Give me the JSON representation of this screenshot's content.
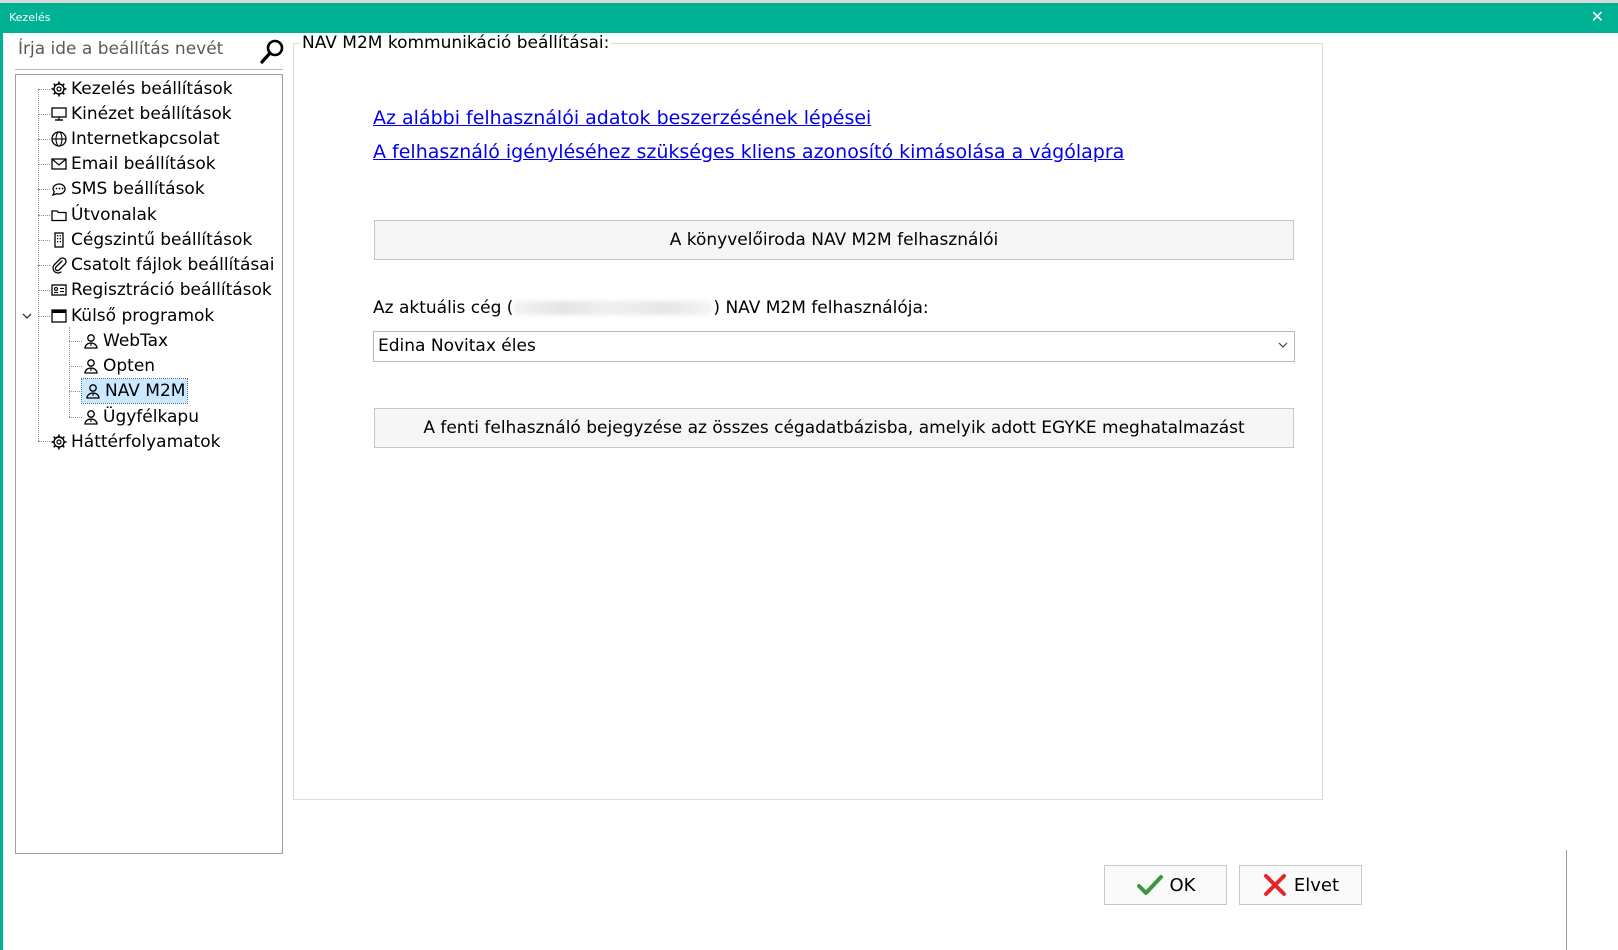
{
  "window": {
    "title": "Kezelés",
    "close_glyph": "✕"
  },
  "search": {
    "placeholder": "Írja ide a beállítás nevét",
    "icon": "search-icon"
  },
  "tree": {
    "items": [
      {
        "label": "Kezelés beállítások",
        "icon": "gear-icon"
      },
      {
        "label": "Kinézet beállítások",
        "icon": "monitor-icon"
      },
      {
        "label": "Internetkapcsolat",
        "icon": "globe-icon"
      },
      {
        "label": "Email beállítások",
        "icon": "envelope-icon"
      },
      {
        "label": "SMS beállítások",
        "icon": "chat-bubble-icon"
      },
      {
        "label": "Útvonalak",
        "icon": "folder-icon"
      },
      {
        "label": "Cégszintű beállítások",
        "icon": "building-icon"
      },
      {
        "label": "Csatolt fájlok beállításai",
        "icon": "paperclip-icon"
      },
      {
        "label": "Regisztráció beállítások",
        "icon": "id-card-icon"
      },
      {
        "label": "Külső programok",
        "icon": "window-icon",
        "expanded": true
      },
      {
        "label": "WebTax",
        "icon": "user-icon"
      },
      {
        "label": "Opten",
        "icon": "user-icon"
      },
      {
        "label": "NAV M2M",
        "icon": "user-icon",
        "selected": true
      },
      {
        "label": "Ügyfélkapu",
        "icon": "user-icon"
      },
      {
        "label": "Háttérfolyamatok",
        "icon": "gear-icon"
      }
    ]
  },
  "panel": {
    "legend": "NAV M2M kommunikáció beállításai:",
    "link1": "Az alábbi felhasználói adatok beszerzésének lépései",
    "link2": "A felhasználó igényléséhez szükséges kliens azonosító kimásolása a vágólapra",
    "button_users": "A könyvelőiroda NAV M2M felhasználói",
    "user_label_prefix": "Az aktuális cég (",
    "user_label_suffix": ") NAV M2M felhasználója:",
    "user_select_value": "Edina Novitax éles",
    "button_register": "A fenti felhasználó bejegyzése az összes cégadatbázisba, amelyik adott EGYKE meghatalmazást"
  },
  "footer": {
    "ok_label": "OK",
    "cancel_label": "Elvet"
  },
  "colors": {
    "titlebar": "#00b294",
    "link": "#0000ee",
    "ok_check": "#3a9a3a",
    "cancel_x": "#e02a2a"
  }
}
